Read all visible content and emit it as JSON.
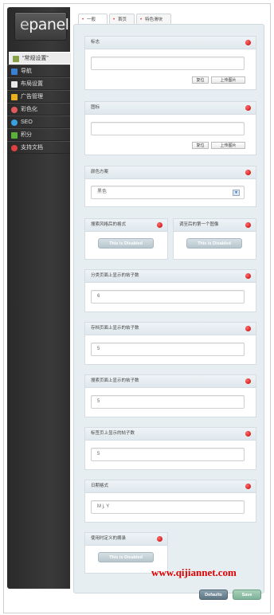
{
  "logo": {
    "prefix": "e",
    "rest": "panel"
  },
  "sidebar": {
    "items": [
      {
        "label": "“常规设置”",
        "icon": "wrench-icon",
        "color": "#8aa04a"
      },
      {
        "label": "导航",
        "icon": "list-icon",
        "color": "#3b7fd0"
      },
      {
        "label": "布局设置",
        "icon": "page-icon",
        "color": "#e8e8e8"
      },
      {
        "label": "广告管理",
        "icon": "grid-icon",
        "color": "#e8b020"
      },
      {
        "label": "彩色化",
        "icon": "palette-icon",
        "color": "#e05a5a"
      },
      {
        "label": "SEO",
        "icon": "globe-icon",
        "color": "#3aa0e0"
      },
      {
        "label": "积分",
        "icon": "chart-icon",
        "color": "#5ab03a"
      },
      {
        "label": "支持文档",
        "icon": "lifebuoy-icon",
        "color": "#e04040"
      }
    ]
  },
  "tabs": [
    {
      "label": "一般"
    },
    {
      "label": "首页"
    },
    {
      "label": "特色滑块"
    }
  ],
  "sections": {
    "logo": {
      "title": "标志",
      "value": "",
      "reset": "复位",
      "upload": "上传图片"
    },
    "favicon": {
      "title": "图标",
      "value": "",
      "reset": "复位",
      "upload": "上传图片"
    },
    "color_scheme": {
      "title": "颜色方案",
      "value": "黑色"
    },
    "grab_image": {
      "title": "搜索风格后的格式",
      "disabled": "This is Disabled"
    },
    "first_image": {
      "title": "调至后的第一个图像",
      "disabled": "This is Disabled"
    },
    "cat_posts": {
      "title": "分类页面上显示的帖子数",
      "value": "6"
    },
    "archive_posts": {
      "title": "存档页面上显示的帖子数",
      "value": "5"
    },
    "search_posts": {
      "title": "搜索页面上显示的帖子数",
      "value": "5"
    },
    "tag_posts": {
      "title": "标签页上显示的帖子数",
      "value": "5"
    },
    "date_format": {
      "title": "日期格式",
      "value": "M j, Y"
    },
    "custom_excerpt": {
      "title": "使用时定义的摘录",
      "disabled": "This is Disabled"
    }
  },
  "footer": {
    "defaults": "Defaults",
    "save": "Save"
  },
  "watermark": "www.qijiannet.com"
}
